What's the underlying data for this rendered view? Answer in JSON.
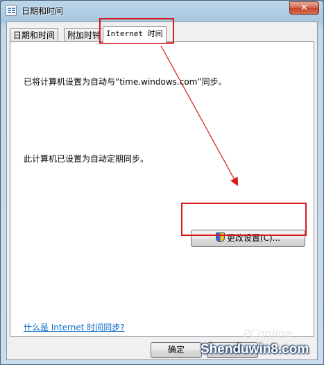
{
  "window": {
    "title": "日期和时间",
    "close_glyph": "✕"
  },
  "tabs": [
    {
      "label": "日期和时间"
    },
    {
      "label": "附加时钟"
    },
    {
      "label": "Internet 时间"
    }
  ],
  "panel": {
    "sync_server_text": "已将计算机设置为自动与“time.windows.com”同步。",
    "auto_sync_text": "此计算机已设置为自动定期同步。",
    "change_settings_label": "更改设置(C)...",
    "help_link": "什么是 Internet 时间同步?"
  },
  "footer": {
    "ok_label": "确定",
    "cancel_label": "取消"
  },
  "watermarks": {
    "pconline": "PConline",
    "site": "Shenduwin8.com"
  },
  "colors": {
    "annotation": "#d81818",
    "link": "#0066cc"
  }
}
